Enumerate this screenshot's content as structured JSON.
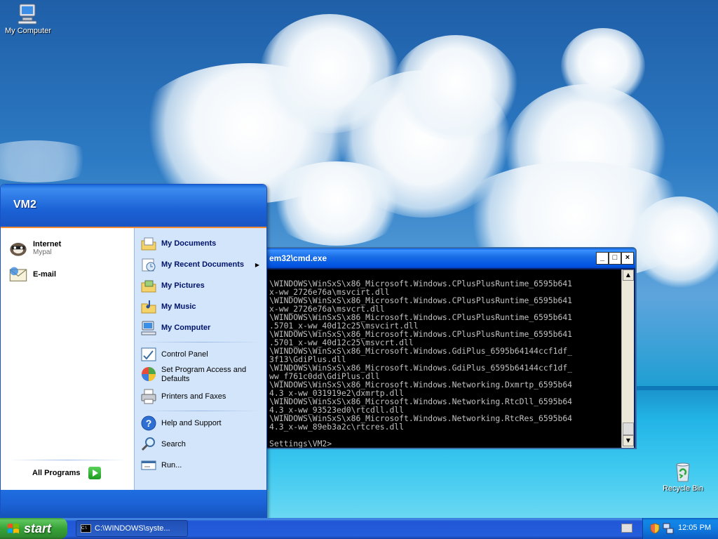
{
  "desktop": {
    "icons": [
      {
        "label": "My Computer",
        "icon": "my-computer-icon"
      },
      {
        "label": "Recycle Bin",
        "icon": "recycle-bin-icon"
      }
    ]
  },
  "cmd_window": {
    "title": "em32\\cmd.exe",
    "lines": [
      "\\WINDOWS\\WinSxS\\x86_Microsoft.Windows.CPlusPlusRuntime_6595b641",
      "x-ww_2726e76a\\msvcirt.dll",
      "\\WINDOWS\\WinSxS\\x86_Microsoft.Windows.CPlusPlusRuntime_6595b641",
      "x-ww_2726e76a\\msvcrt.dll",
      "\\WINDOWS\\WinSxS\\x86_Microsoft.Windows.CPlusPlusRuntime_6595b641",
      ".5701_x-ww_40d12c25\\msvcirt.dll",
      "\\WINDOWS\\WinSxS\\x86_Microsoft.Windows.CPlusPlusRuntime_6595b641",
      ".5701_x-ww_40d12c25\\msvcrt.dll",
      "\\WINDOWS\\WinSxS\\x86_Microsoft.Windows.GdiPlus_6595b64144ccf1df_",
      "3f13\\GdiPlus.dll",
      "\\WINDOWS\\WinSxS\\x86_Microsoft.Windows.GdiPlus_6595b64144ccf1df_",
      "ww_f761c0dd\\GdiPlus.dll",
      "\\WINDOWS\\WinSxS\\x86_Microsoft.Windows.Networking.Dxmrtp_6595b64",
      "4.3_x-ww_031919e2\\dxmrtp.dll",
      "\\WINDOWS\\WinSxS\\x86_Microsoft.Windows.Networking.RtcDll_6595b64",
      "4.3_x-ww_93523ed0\\rtcdll.dll",
      "\\WINDOWS\\WinSxS\\x86_Microsoft.Windows.Networking.RtcRes_6595b64",
      "4.3_x-ww_89eb3a2c\\rtcres.dll",
      "",
      "Settings\\VM2>"
    ],
    "buttons": {
      "minimize": "_",
      "maximize": "□",
      "close": "×"
    }
  },
  "start_menu": {
    "user": "VM2",
    "pinned": [
      {
        "label": "Internet",
        "sub": "Mypal",
        "icon": "internet-browser-icon"
      },
      {
        "label": "E-mail",
        "icon": "email-icon"
      }
    ],
    "all_programs": "All Programs",
    "places": [
      {
        "label": "My Documents",
        "icon": "my-documents-icon"
      },
      {
        "label": "My Recent Documents",
        "icon": "recent-documents-icon",
        "submenu": true
      },
      {
        "label": "My Pictures",
        "icon": "my-pictures-icon"
      },
      {
        "label": "My Music",
        "icon": "my-music-icon"
      },
      {
        "label": "My Computer",
        "icon": "my-computer-icon"
      }
    ],
    "settings": [
      {
        "label": "Control Panel",
        "icon": "control-panel-icon"
      },
      {
        "label": "Set Program Access and Defaults",
        "icon": "program-access-icon"
      },
      {
        "label": "Printers and Faxes",
        "icon": "printer-icon"
      }
    ],
    "help": [
      {
        "label": "Help and Support",
        "icon": "help-icon"
      },
      {
        "label": "Search",
        "icon": "search-icon"
      },
      {
        "label": "Run...",
        "icon": "run-icon"
      }
    ]
  },
  "taskbar": {
    "start_label": "start",
    "tasks": [
      {
        "label": "C:\\WINDOWS\\syste...",
        "icon": "cmd-icon"
      }
    ],
    "clock": "12:05 PM"
  },
  "colors": {
    "taskbar_blue": "#245edb",
    "start_green": "#37a337",
    "menu_right_bg": "#d3e5fa"
  }
}
